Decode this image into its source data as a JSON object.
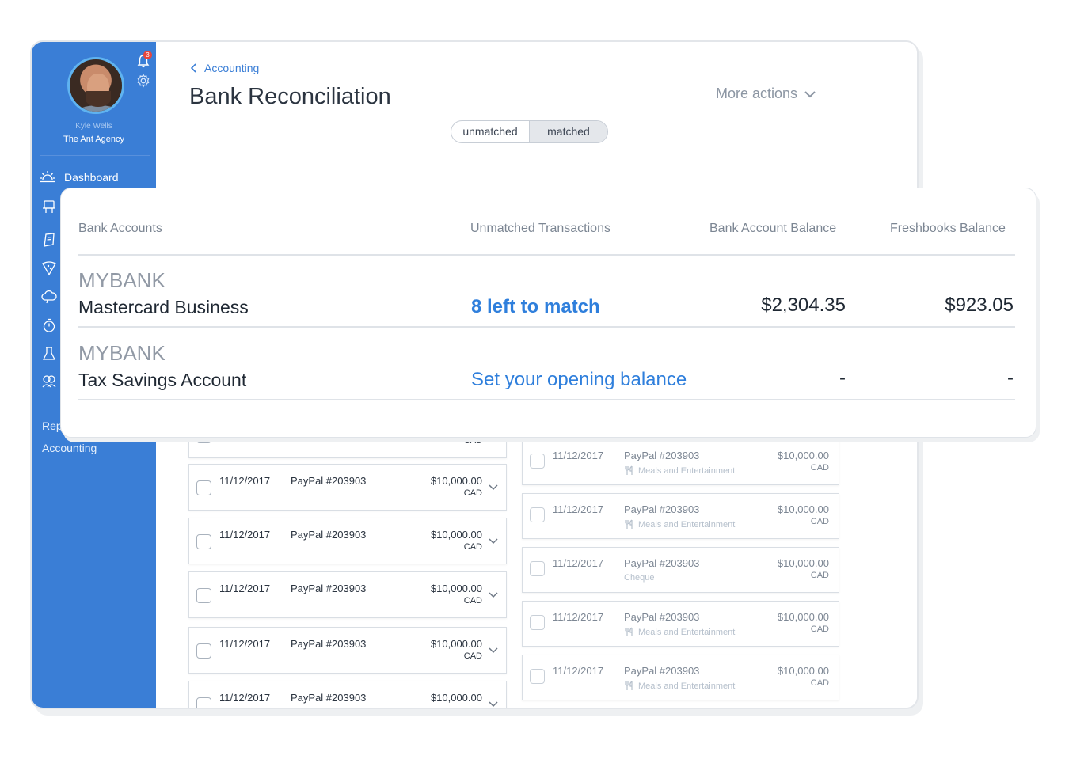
{
  "sidebar": {
    "user_name": "Kyle Wells",
    "company": "The Ant Agency",
    "notification_count": "3",
    "nav": {
      "dashboard": "Dashboard",
      "reports_partial": "Rep",
      "accounting": "Accounting"
    }
  },
  "header": {
    "breadcrumb": "Accounting",
    "title": "Bank Reconciliation",
    "more_actions": "More actions",
    "toggle": {
      "unmatched": "unmatched",
      "matched": "matched"
    }
  },
  "unmatched_transactions": [
    {
      "date": "",
      "description": "",
      "amount": "",
      "currency": "CAD"
    },
    {
      "date": "11/12/2017",
      "description": "PayPal #203903",
      "amount": "$10,000.00",
      "currency": "CAD"
    },
    {
      "date": "11/12/2017",
      "description": "PayPal #203903",
      "amount": "$10,000.00",
      "currency": "CAD"
    },
    {
      "date": "11/12/2017",
      "description": "PayPal #203903",
      "amount": "$10,000.00",
      "currency": "CAD"
    },
    {
      "date": "11/12/2017",
      "description": "PayPal #203903",
      "amount": "$10,000.00",
      "currency": "CAD"
    },
    {
      "date": "11/12/2017",
      "description": "PayPal #203903",
      "amount": "$10,000.00",
      "currency": ""
    }
  ],
  "matched_transactions": [
    {
      "date": "11/12/2017",
      "description": "PayPal #203903",
      "category": "Meals and Entertainment",
      "category_icon": "utensils-icon",
      "amount": "$10,000.00",
      "currency": "CAD"
    },
    {
      "date": "11/12/2017",
      "description": "PayPal #203903",
      "category": "Meals and Entertainment",
      "category_icon": "utensils-icon",
      "amount": "$10,000.00",
      "currency": "CAD"
    },
    {
      "date": "11/12/2017",
      "description": "PayPal #203903",
      "category": "Cheque",
      "category_icon": "",
      "amount": "$10,000.00",
      "currency": "CAD"
    },
    {
      "date": "11/12/2017",
      "description": "PayPal #203903",
      "category": "Meals and Entertainment",
      "category_icon": "utensils-icon",
      "amount": "$10,000.00",
      "currency": "CAD"
    },
    {
      "date": "11/12/2017",
      "description": "PayPal #203903",
      "category": "Meals and Entertainment",
      "category_icon": "utensils-icon",
      "amount": "$10,000.00",
      "currency": "CAD"
    }
  ],
  "bank_accounts": {
    "headers": {
      "accounts": "Bank Accounts",
      "unmatched": "Unmatched Transactions",
      "bank_balance": "Bank Account Balance",
      "freshbooks_balance": "Freshbooks Balance"
    },
    "rows": [
      {
        "bank": "MYBANK",
        "account": "Mastercard Business",
        "status": "8 left to match",
        "bank_balance": "$2,304.35",
        "freshbooks_balance": "$923.05"
      },
      {
        "bank": "MYBANK",
        "account": "Tax Savings Account",
        "status": "Set your opening balance",
        "bank_balance": "-",
        "freshbooks_balance": "-"
      }
    ]
  },
  "colors": {
    "sidebar": "#3a7ed6",
    "link": "#2f7fdc",
    "badge": "#e8453c"
  }
}
